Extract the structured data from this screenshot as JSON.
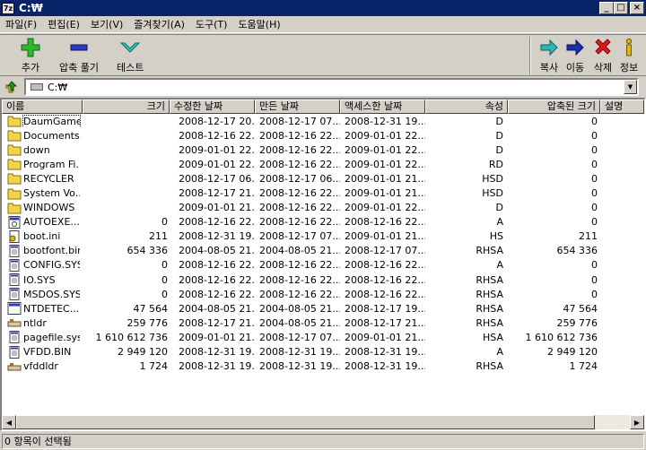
{
  "window": {
    "icon_text": "7z",
    "title": "C:₩"
  },
  "menu": [
    "파일(F)",
    "편집(E)",
    "보기(V)",
    "즐겨찾기(A)",
    "도구(T)",
    "도움말(H)"
  ],
  "toolbar": {
    "add": "추가",
    "extract": "압축 풀기",
    "test": "테스트",
    "copy": "복사",
    "move": "이동",
    "delete": "삭제",
    "info": "정보"
  },
  "address": {
    "value": "C:₩"
  },
  "columns": {
    "name": "이름",
    "size": "크기",
    "modified": "수정한 날짜",
    "created": "만든 날짜",
    "accessed": "액세스한 날짜",
    "attributes": "속성",
    "packed": "압축된 크기",
    "comment": "설명"
  },
  "files": [
    {
      "icon": "folder",
      "name": "DaumGame",
      "size": "",
      "modified": "2008-12-17 20...",
      "created": "2008-12-17 07...",
      "accessed": "2008-12-31 19...",
      "attr": "D",
      "packed": "0"
    },
    {
      "icon": "folder",
      "name": "Documents...",
      "size": "",
      "modified": "2008-12-16 22...",
      "created": "2008-12-16 22...",
      "accessed": "2009-01-01 22...",
      "attr": "D",
      "packed": "0"
    },
    {
      "icon": "folder",
      "name": "down",
      "size": "",
      "modified": "2009-01-01 22...",
      "created": "2008-12-16 22...",
      "accessed": "2009-01-01 22...",
      "attr": "D",
      "packed": "0"
    },
    {
      "icon": "folder",
      "name": "Program Fi...",
      "size": "",
      "modified": "2009-01-01 22...",
      "created": "2008-12-16 22...",
      "accessed": "2009-01-01 22...",
      "attr": "RD",
      "packed": "0"
    },
    {
      "icon": "folder",
      "name": "RECYCLER",
      "size": "",
      "modified": "2008-12-17 06...",
      "created": "2008-12-17 06...",
      "accessed": "2009-01-01 21...",
      "attr": "HSD",
      "packed": "0"
    },
    {
      "icon": "folder",
      "name": "System Vo...",
      "size": "",
      "modified": "2008-12-17 21...",
      "created": "2008-12-16 22...",
      "accessed": "2009-01-01 21...",
      "attr": "HSD",
      "packed": "0"
    },
    {
      "icon": "folder",
      "name": "WINDOWS",
      "size": "",
      "modified": "2009-01-01 21...",
      "created": "2008-12-16 22...",
      "accessed": "2009-01-01 22...",
      "attr": "D",
      "packed": "0"
    },
    {
      "icon": "bat",
      "name": "AUTOEXE...",
      "size": "0",
      "modified": "2008-12-16 22...",
      "created": "2008-12-16 22...",
      "accessed": "2008-12-16 22...",
      "attr": "A",
      "packed": "0"
    },
    {
      "icon": "ini",
      "name": "boot.ini",
      "size": "211",
      "modified": "2008-12-31 19...",
      "created": "2008-12-17 07...",
      "accessed": "2009-01-01 21...",
      "attr": "HS",
      "packed": "211"
    },
    {
      "icon": "doc",
      "name": "bootfont.bin",
      "size": "654 336",
      "modified": "2004-08-05 21...",
      "created": "2004-08-05 21...",
      "accessed": "2008-12-17 07...",
      "attr": "RHSA",
      "packed": "654 336"
    },
    {
      "icon": "doc",
      "name": "CONFIG.SYS",
      "size": "0",
      "modified": "2008-12-16 22...",
      "created": "2008-12-16 22...",
      "accessed": "2008-12-16 22...",
      "attr": "A",
      "packed": "0"
    },
    {
      "icon": "doc",
      "name": "IO.SYS",
      "size": "0",
      "modified": "2008-12-16 22...",
      "created": "2008-12-16 22...",
      "accessed": "2008-12-16 22...",
      "attr": "RHSA",
      "packed": "0"
    },
    {
      "icon": "doc",
      "name": "MSDOS.SYS",
      "size": "0",
      "modified": "2008-12-16 22...",
      "created": "2008-12-16 22...",
      "accessed": "2008-12-16 22...",
      "attr": "RHSA",
      "packed": "0"
    },
    {
      "icon": "com",
      "name": "NTDETEC...",
      "size": "47 564",
      "modified": "2004-08-05 21...",
      "created": "2004-08-05 21...",
      "accessed": "2008-12-17 19...",
      "attr": "RHSA",
      "packed": "47 564"
    },
    {
      "icon": "ldr",
      "name": "ntldr",
      "size": "259 776",
      "modified": "2008-12-17 21...",
      "created": "2004-08-05 21...",
      "accessed": "2008-12-17 21...",
      "attr": "RHSA",
      "packed": "259 776"
    },
    {
      "icon": "doc",
      "name": "pagefile.sys",
      "size": "1 610 612 736",
      "modified": "2009-01-01 21...",
      "created": "2008-12-17 07...",
      "accessed": "2009-01-01 21...",
      "attr": "HSA",
      "packed": "1 610 612 736"
    },
    {
      "icon": "doc",
      "name": "VFDD.BIN",
      "size": "2 949 120",
      "modified": "2008-12-31 19...",
      "created": "2008-12-31 19...",
      "accessed": "2008-12-31 19...",
      "attr": "A",
      "packed": "2 949 120"
    },
    {
      "icon": "ldr",
      "name": "vfddldr",
      "size": "1 724",
      "modified": "2008-12-31 19...",
      "created": "2008-12-31 19...",
      "accessed": "2008-12-31 19...",
      "attr": "RHSA",
      "packed": "1 724"
    }
  ],
  "status": "0 항목이 선택됨"
}
